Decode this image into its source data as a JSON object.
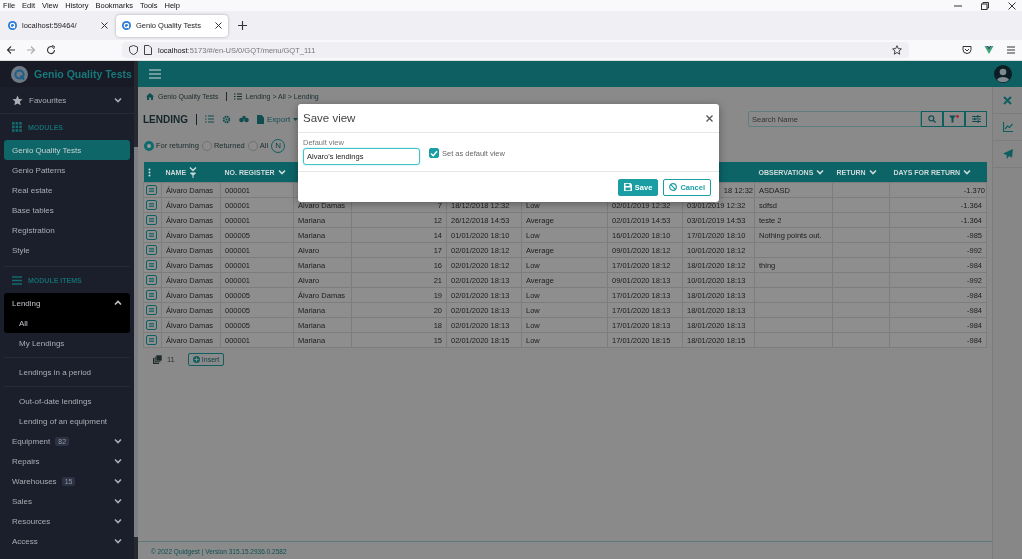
{
  "browser": {
    "menu": [
      "File",
      "Edit",
      "View",
      "History",
      "Bookmarks",
      "Tools",
      "Help"
    ],
    "tabs": [
      {
        "title": "localhost:59464/",
        "selected": false
      },
      {
        "title": "Genio Quality Tests",
        "selected": true
      }
    ],
    "url_host": "localhost",
    "url_path": ":5173/#/en-US/0/GQT/menu/GQT_111"
  },
  "sidebar": {
    "brand": "Genio Quality Tests",
    "favourites": "Favourites",
    "modules_heading": "MODULES",
    "modules": [
      {
        "label": "Genio Quality Tests",
        "selected": true
      },
      {
        "label": "Genio Patterns",
        "selected": false
      },
      {
        "label": "Real estate",
        "selected": false
      },
      {
        "label": "Base tables",
        "selected": false
      },
      {
        "label": "Registration",
        "selected": false
      },
      {
        "label": "Style",
        "selected": false
      }
    ],
    "items_heading": "MODULE ITEMS",
    "items": [
      {
        "label": "Lending",
        "expanded": true,
        "children": [
          {
            "label": "All",
            "selected": true,
            "divider_before": false
          },
          {
            "label": "My Lendings",
            "selected": false,
            "divider_before": false
          },
          {
            "label": "Lendings in a period",
            "selected": false,
            "divider_before": true
          },
          {
            "label": "Out-of-date lendings",
            "selected": false,
            "divider_before": true
          },
          {
            "label": "Lending of an equipment",
            "selected": false,
            "divider_before": false
          }
        ]
      },
      {
        "label": "Equipment",
        "badge": "82",
        "expanded": false
      },
      {
        "label": "Repairs",
        "expanded": false
      },
      {
        "label": "Warehouses",
        "badge": "15",
        "expanded": false
      },
      {
        "label": "Sales",
        "expanded": false
      },
      {
        "label": "Resources",
        "expanded": false
      },
      {
        "label": "Access",
        "expanded": false
      }
    ]
  },
  "breadcrumb": {
    "home": "Genio Quality Tests",
    "path": "Lending > All > Lending"
  },
  "toolbar": {
    "title": "LENDING",
    "export": "Export"
  },
  "filters": [
    {
      "label": "For returning",
      "selected": true
    },
    {
      "label": "Returned",
      "selected": false
    },
    {
      "label": "All",
      "selected": false
    }
  ],
  "filter_button": "N",
  "search": {
    "placeholder": "Search Name"
  },
  "table": {
    "headers_left": [
      "NAME",
      "NO. REGISTER"
    ],
    "headers_right": [
      "OBSERVATIONS",
      "RETURN",
      "DAYS FOR RETURN"
    ],
    "rows": [
      {
        "partly_hidden": true,
        "name": "Álvaro Damas",
        "no_register": "000001",
        "column_8": "18 12:32",
        "observations": "ASDASD",
        "days_for_return": "-1.370"
      },
      {
        "name": "Álvaro Damas",
        "no_register": "000001",
        "column_3": "Álvaro Damas",
        "column_4": "7",
        "column_5": "18/12/2018 12:32",
        "column_6": "Low",
        "column_7": "02/01/2019 12:32",
        "column_8": "03/01/2019 12:32",
        "observations": "sdfsd",
        "days_for_return": "-1.364"
      },
      {
        "name": "Álvaro Damas",
        "no_register": "000001",
        "column_3": "Mariana",
        "column_4": "12",
        "column_5": "26/12/2018 14:53",
        "column_6": "Average",
        "column_7": "02/01/2019 14:53",
        "column_8": "03/01/2019 14:53",
        "observations": "teste 2",
        "days_for_return": "-1.364"
      },
      {
        "name": "Álvaro Damas",
        "no_register": "000005",
        "column_3": "Mariana",
        "column_4": "14",
        "column_5": "01/01/2020 18:10",
        "column_6": "Low",
        "column_7": "16/01/2020 18:10",
        "column_8": "17/01/2020 18:10",
        "observations": "Nothing points out.",
        "days_for_return": "-985"
      },
      {
        "name": "Álvaro Damas",
        "no_register": "000001",
        "column_3": "Alvaro",
        "column_4": "17",
        "column_5": "02/01/2020 18:12",
        "column_6": "Average",
        "column_7": "09/01/2020 18:12",
        "column_8": "10/01/2020 18:12",
        "days_for_return": "-992"
      },
      {
        "name": "Álvaro Damas",
        "no_register": "000001",
        "column_3": "Mariana",
        "column_4": "16",
        "column_5": "02/01/2020 18:12",
        "column_6": "Low",
        "column_7": "17/01/2020 18:12",
        "column_8": "18/01/2020 18:12",
        "observations": "thing",
        "days_for_return": "-984"
      },
      {
        "name": "Álvaro Damas",
        "no_register": "000001",
        "column_3": "Alvaro",
        "column_4": "21",
        "column_5": "02/01/2020 18:13",
        "column_6": "Average",
        "column_7": "09/01/2020 18:13",
        "column_8": "10/01/2020 18:13",
        "days_for_return": "-992"
      },
      {
        "name": "Álvaro Damas",
        "no_register": "000005",
        "column_3": "Álvaro Damas",
        "column_4": "19",
        "column_5": "02/01/2020 18:13",
        "column_6": "Low",
        "column_7": "17/01/2020 18:13",
        "column_8": "18/01/2020 18:13",
        "days_for_return": "-984"
      },
      {
        "name": "Álvaro Damas",
        "no_register": "000005",
        "column_3": "Mariana",
        "column_4": "20",
        "column_5": "02/01/2020 18:13",
        "column_6": "Low",
        "column_7": "17/01/2020 18:13",
        "column_8": "18/01/2020 18:13",
        "days_for_return": "-984"
      },
      {
        "name": "Álvaro Damas",
        "no_register": "000005",
        "column_3": "Mariana",
        "column_4": "18",
        "column_5": "02/01/2020 18:13",
        "column_6": "Low",
        "column_7": "17/01/2020 18:13",
        "column_8": "18/01/2020 18:13",
        "days_for_return": "-984"
      },
      {
        "name": "Álvaro Damas",
        "no_register": "000001",
        "column_3": "Mariana",
        "column_4": "15",
        "column_5": "02/01/2020 18:15",
        "column_6": "Low",
        "column_7": "17/01/2020 18:15",
        "column_8": "18/01/2020 18:15",
        "days_for_return": "-984"
      }
    ]
  },
  "table_footer": {
    "count": "11",
    "insert": "Insert"
  },
  "footer": "© 2022 Quidgest | Version 315.15.2936.0.2582",
  "modal": {
    "title": "Save view",
    "field_label": "Default view",
    "value": "Alvaro's lendings",
    "checkbox": {
      "label": "Set as default view",
      "checked": true
    },
    "buttons": [
      {
        "label": "Save",
        "kind": "primary"
      },
      {
        "label": "Cancel",
        "kind": "secondary"
      }
    ]
  }
}
